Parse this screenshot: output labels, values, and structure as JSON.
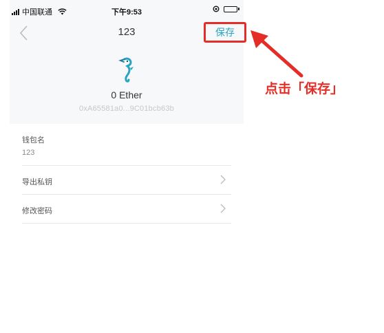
{
  "status_bar": {
    "carrier": "中国联通",
    "time": "下午9:53"
  },
  "nav": {
    "title": "123",
    "save_label": "保存"
  },
  "wallet": {
    "icon": "seahorse-icon",
    "balance": "0 Ether",
    "address": "0xA65581a0...9C01bcb63b"
  },
  "form": {
    "name_label": "钱包名",
    "name_value": "123",
    "rows": [
      {
        "label": "导出私钥",
        "icon": "chevron-right-icon"
      },
      {
        "label": "修改密码",
        "icon": "chevron-right-icon"
      }
    ]
  },
  "annotation": {
    "text": "点击「保存」"
  },
  "colors": {
    "accent": "#2aa3c2",
    "annotation_red": "#e52d27",
    "header_bg": "#f7f8f9",
    "muted_text": "#c4c8cc"
  }
}
